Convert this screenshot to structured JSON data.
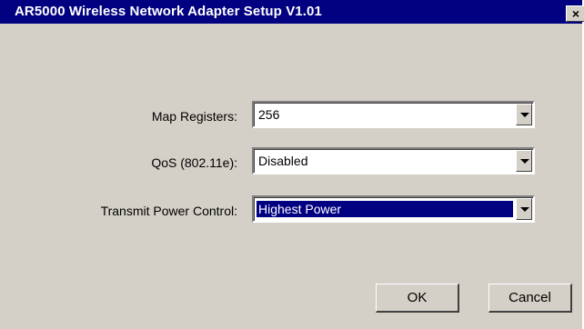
{
  "window": {
    "title": "AR5000 Wireless Network Adapter Setup V1.01",
    "close_label": "×"
  },
  "fields": [
    {
      "label": "Map Registers:",
      "value": "256",
      "focused": false
    },
    {
      "label": "QoS (802.11e):",
      "value": "Disabled",
      "focused": false
    },
    {
      "label": "Transmit Power Control:",
      "value": "Highest Power",
      "focused": true
    }
  ],
  "buttons": {
    "ok_label": "OK",
    "cancel_label": "Cancel"
  },
  "icons": {
    "close": "close-icon",
    "dropdown": "chevron-down-icon"
  },
  "colors": {
    "titlebar": "#000080",
    "face": "#d4d0c8",
    "selection": "#000080"
  }
}
